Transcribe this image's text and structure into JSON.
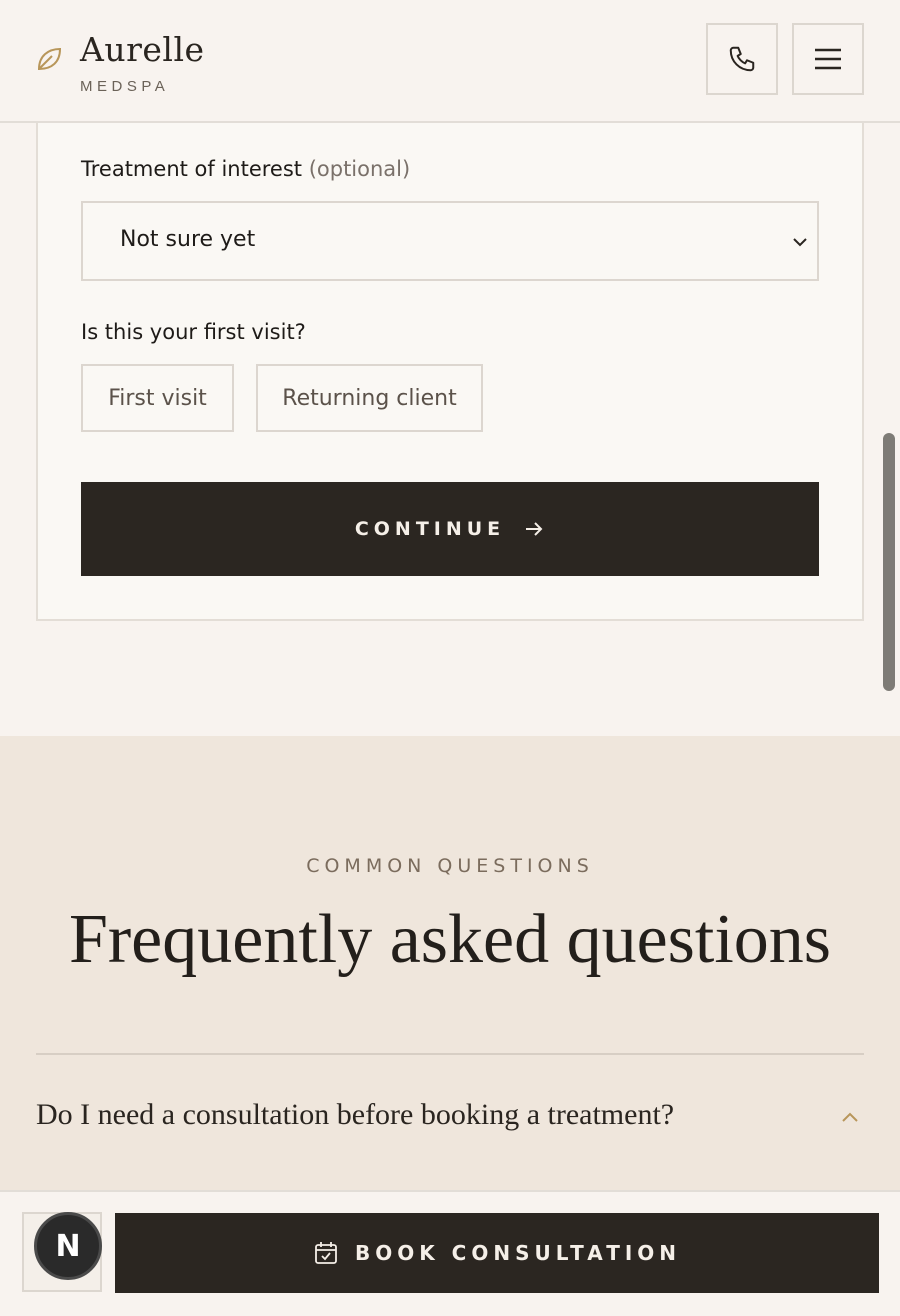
{
  "header": {
    "brand_name": "Aurelle",
    "brand_sub": "MEDSPA",
    "icons": {
      "logo": "leaf-icon",
      "phone": "phone-icon",
      "menu": "hamburger-menu-icon"
    },
    "accent_color": "#b8965a"
  },
  "form": {
    "treatment_label": "Treatment of interest",
    "treatment_optional": "(optional)",
    "treatment_selected": "Not sure yet",
    "first_visit_label": "Is this your first visit?",
    "options": [
      "First visit",
      "Returning client"
    ],
    "continue_label": "CONTINUE"
  },
  "faq": {
    "eyebrow": "COMMON QUESTIONS",
    "title": "Frequently asked questions",
    "items": [
      {
        "question": "Do I need a consultation before booking a treatment?",
        "expanded": true
      }
    ]
  },
  "bottom_bar": {
    "avatar_letter": "N",
    "book_label": "BOOK CONSULTATION"
  },
  "colors": {
    "dark_button": "#2b2621",
    "background": "#f8f3ef",
    "faq_background": "#efe6dc"
  }
}
